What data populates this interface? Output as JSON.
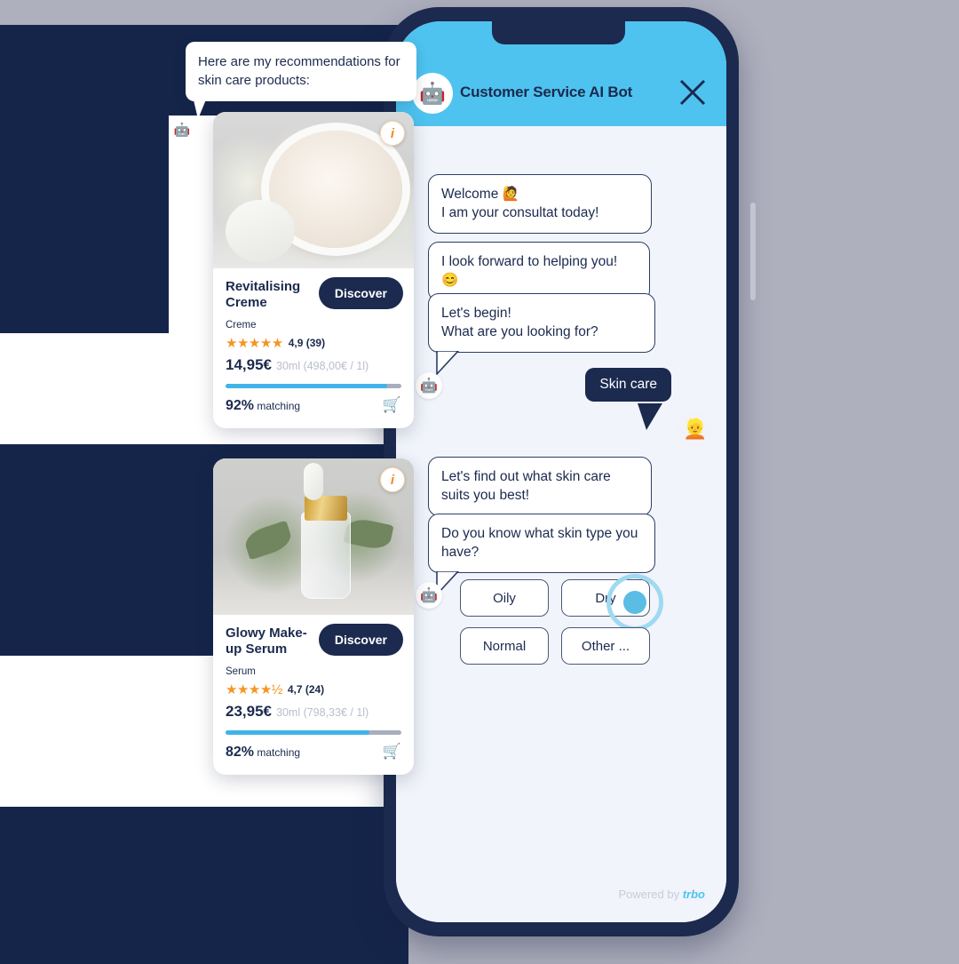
{
  "background": {
    "page_bg_color": "#AFB0BE",
    "navy_color": "#15254A"
  },
  "phone": {
    "frame_color": "#1B2A4E",
    "screen_bg": "#F1F4FB"
  },
  "chat_header": {
    "title": "Customer Service AI Bot",
    "bot_avatar_icon": "robot-icon",
    "close_icon": "close-icon",
    "bg_color": "#4EC3F0"
  },
  "messages": [
    {
      "id": "m1",
      "sender": "bot",
      "text": "Welcome 🙋\nI am your consultat today!"
    },
    {
      "id": "m2",
      "sender": "bot",
      "text": "I look forward to helping you! 😊"
    },
    {
      "id": "m3",
      "sender": "bot",
      "text": "Let's begin!\nWhat are you looking for?"
    },
    {
      "id": "m4",
      "sender": "user",
      "text": "Skin care"
    },
    {
      "id": "m5",
      "sender": "bot",
      "text": "Let's find out what skin care suits you best!"
    },
    {
      "id": "m6",
      "sender": "bot",
      "text": "Do you know what skin type you have?"
    }
  ],
  "quick_replies": [
    {
      "label": "Oily",
      "selected": false
    },
    {
      "label": "Dry",
      "selected": true
    },
    {
      "label": "Normal",
      "selected": false
    },
    {
      "label": "Other ...",
      "selected": false
    }
  ],
  "footer": {
    "powered_prefix": "Powered by",
    "brand": "trbo",
    "brand_color": "#4EC3F0"
  },
  "intro": {
    "text": "Here are my recommendations for skin care products:",
    "avatar_icon": "robot-icon"
  },
  "products": [
    {
      "title": "Revitalising Creme",
      "category": "Creme",
      "stars": "★★★★★",
      "rating": "4,9 (39)",
      "price": "14,95€",
      "unit_price": "30ml (498,00€ / 1l)",
      "match_value": "92%",
      "match_label": "matching",
      "match_percent": 92,
      "discover_label": "Discover",
      "info_icon": "info-icon",
      "cart_icon": "cart-icon",
      "image_alt": "cream-jar-photo"
    },
    {
      "title": "Glowy Make-up Serum",
      "category": "Serum",
      "stars": "★★★★½",
      "rating": "4,7 (24)",
      "price": "23,95€",
      "unit_price": "30ml (798,33€ / 1l)",
      "match_value": "82%",
      "match_label": "matching",
      "match_percent": 82,
      "discover_label": "Discover",
      "info_icon": "info-icon",
      "cart_icon": "cart-icon",
      "image_alt": "serum-dropper-photo"
    }
  ]
}
